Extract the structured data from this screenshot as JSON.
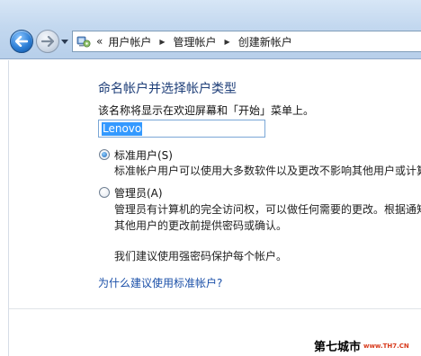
{
  "breadcrumb": {
    "overflow": "«",
    "items": [
      "用户帐户",
      "管理帐户",
      "创建新帐户"
    ]
  },
  "icons": {
    "back": "back-arrow-icon",
    "forward": "forward-arrow-icon",
    "history": "chevron-down-icon",
    "location": "control-panel-icon",
    "separator": "breadcrumb-arrow-icon"
  },
  "main": {
    "title": "命名帐户并选择帐户类型",
    "name_prompt": "该名称将显示在欢迎屏幕和「开始」菜单上。",
    "name_value": "Lenovo",
    "options": [
      {
        "label": "标准用户(S)",
        "checked": true,
        "description": [
          "标准帐户用户可以使用大多数软件以及更改不影响其他用户或计算"
        ]
      },
      {
        "label": "管理员(A)",
        "checked": false,
        "description": [
          "管理员有计算机的完全访问权，可以做任何需要的更改。根据通知",
          "其他用户的更改前提供密码或确认。"
        ]
      }
    ],
    "recommendation": "我们建议使用强密码保护每个帐户。",
    "help_link": "为什么建议使用标准帐户?"
  },
  "watermark": {
    "site_name": "第七城市",
    "site_url": "www.TH7.CN"
  },
  "colors": {
    "title": "#1e3e78",
    "link": "#1a4fa8",
    "selection": "#3399ff",
    "watermark_url": "#d83b1d"
  }
}
